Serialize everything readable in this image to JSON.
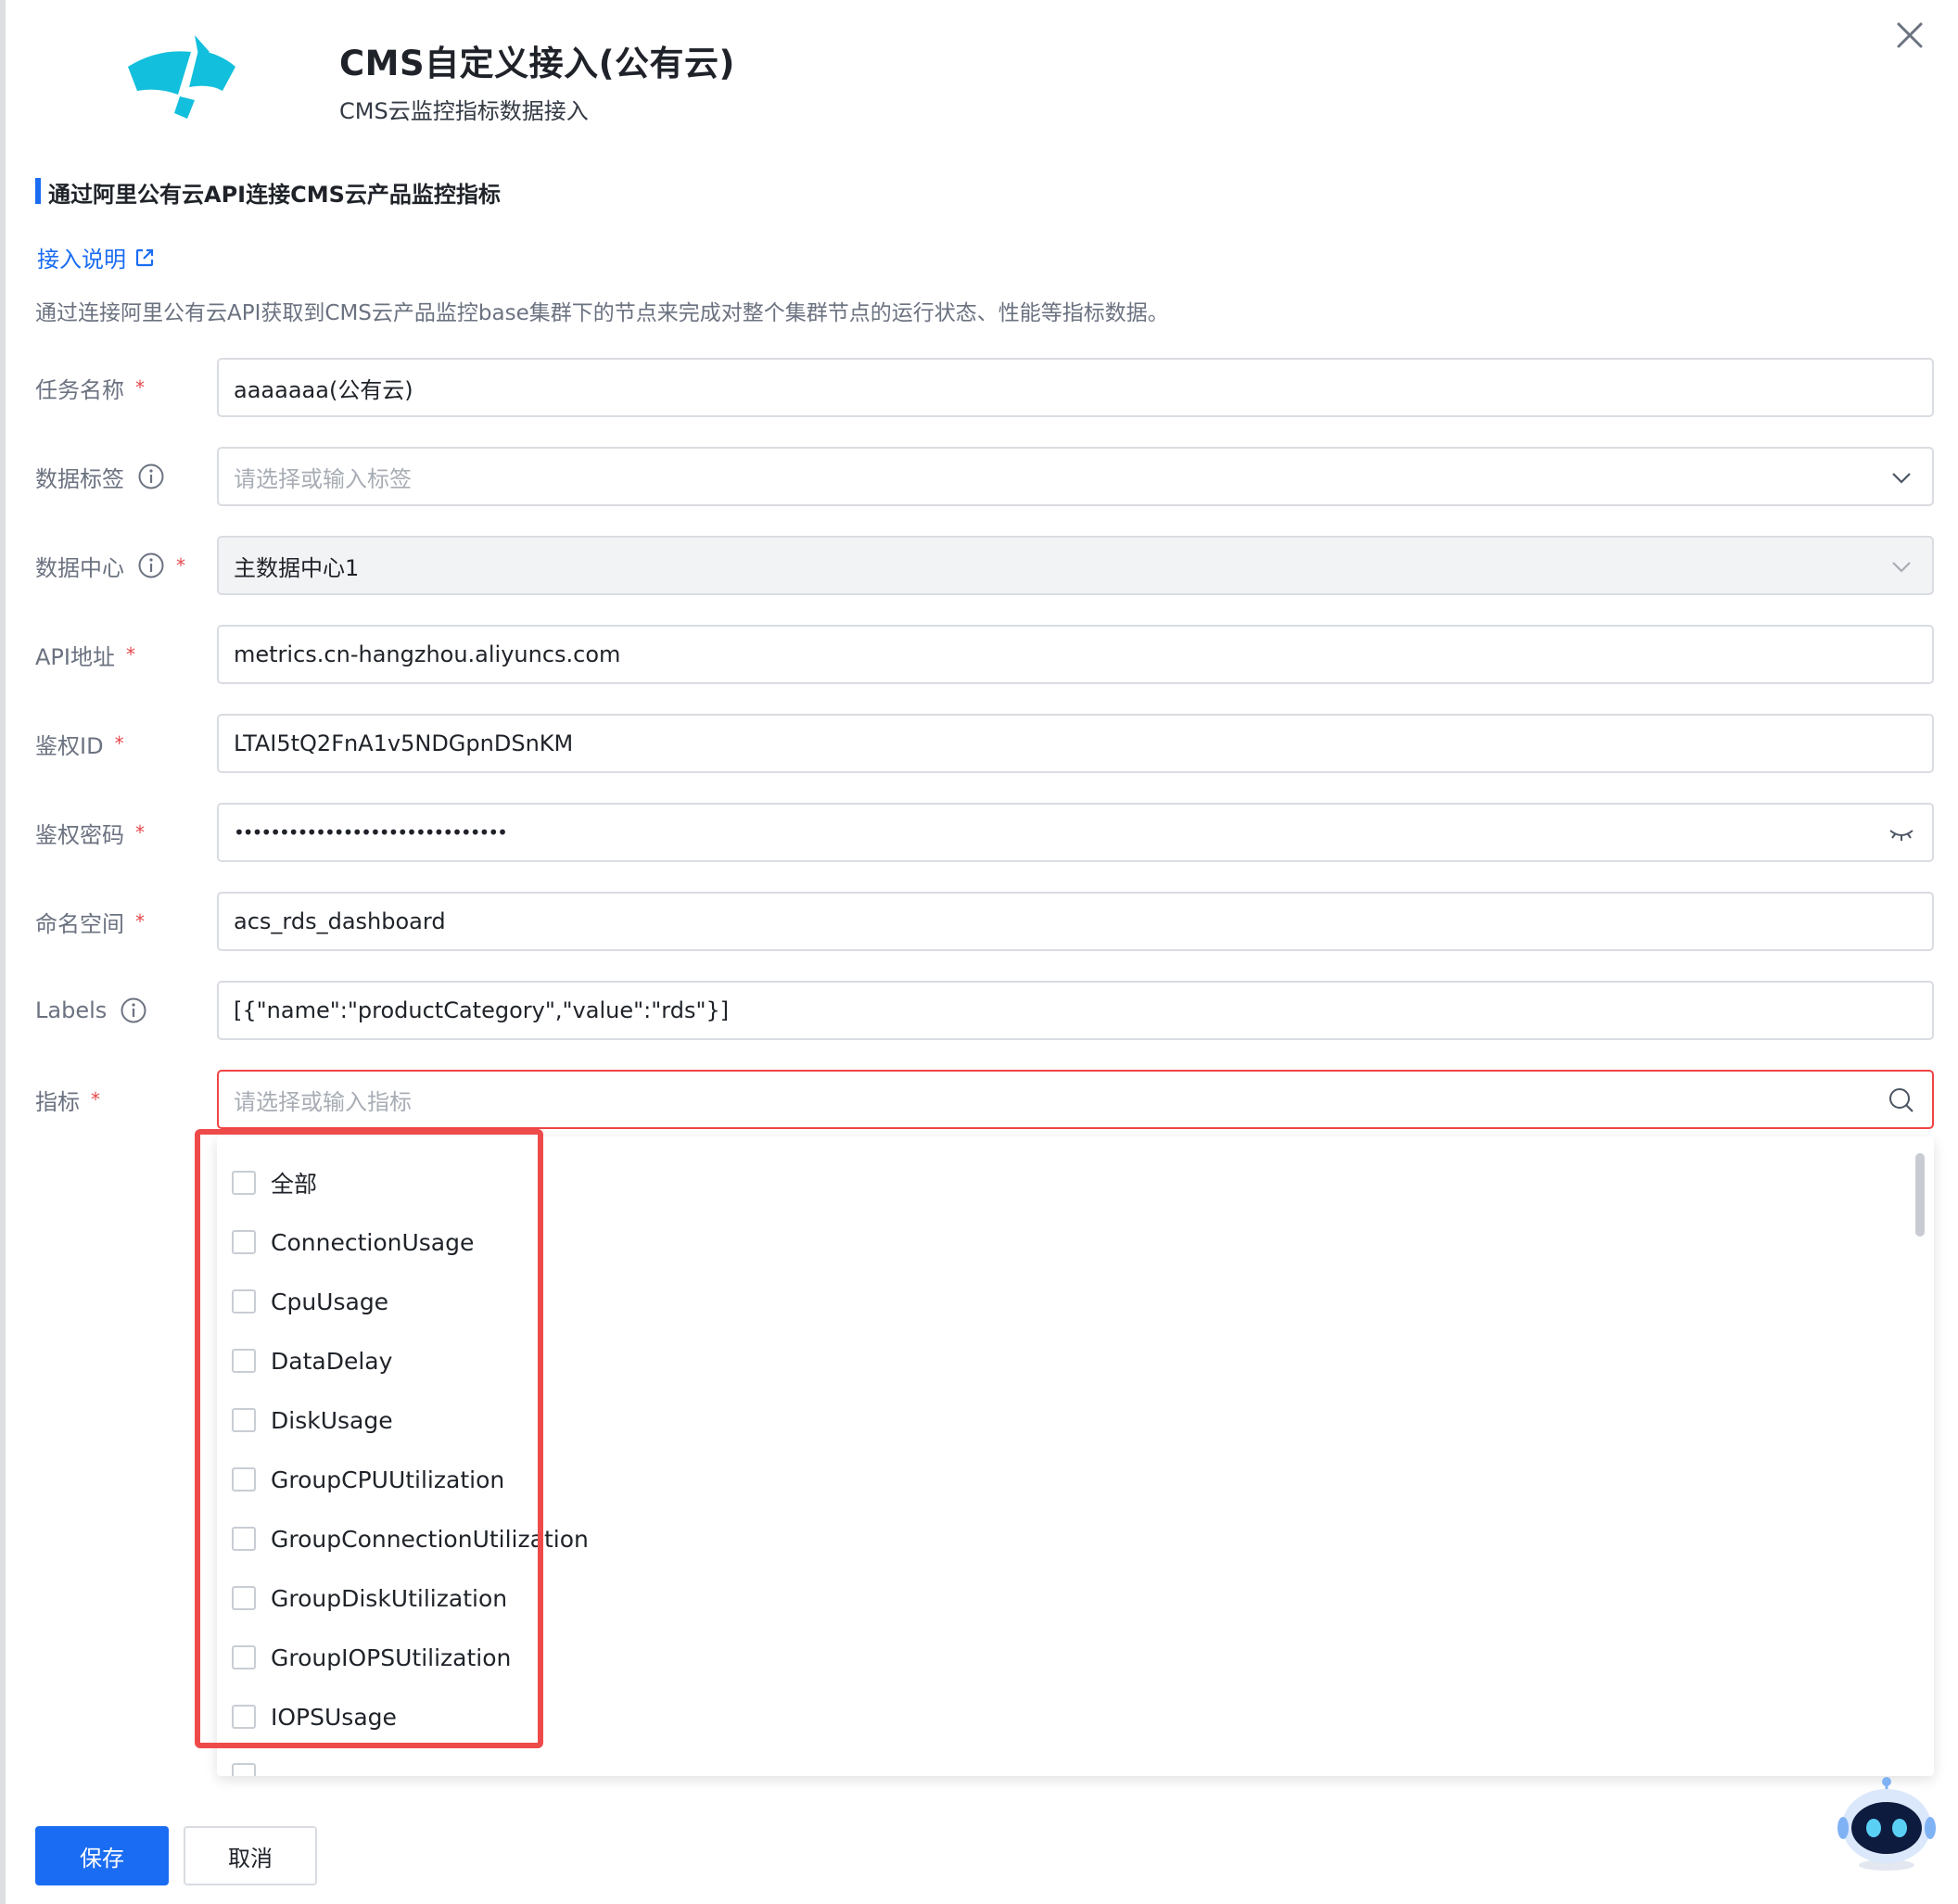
{
  "header": {
    "title": "CMS自定义接入(公有云)",
    "subtitle": "CMS云监控指标数据接入"
  },
  "section": {
    "title": "通过阿里公有云API连接CMS云产品监控指标",
    "doc_link": "接入说明",
    "description": "通过连接阿里公有云API获取到CMS云产品监控base集群下的节点来完成对整个集群节点的运行状态、性能等指标数据。"
  },
  "form": {
    "task_name": {
      "label": "任务名称",
      "value": "aaaaaaa(公有云)"
    },
    "data_tag": {
      "label": "数据标签",
      "placeholder": "请选择或输入标签"
    },
    "data_center": {
      "label": "数据中心",
      "value": "主数据中心1"
    },
    "api_address": {
      "label": "API地址",
      "value": "metrics.cn-hangzhou.aliyuncs.com"
    },
    "auth_id": {
      "label": "鉴权ID",
      "value": "LTAI5tQ2FnA1v5NDGpnDSnKM"
    },
    "auth_secret": {
      "label": "鉴权密码",
      "value": "••••••••••••••••••••••••••••••"
    },
    "namespace": {
      "label": "命名空间",
      "value": "acs_rds_dashboard"
    },
    "labels": {
      "label": "Labels",
      "value": "[{\"name\":\"productCategory\",\"value\":\"rds\"}]"
    },
    "metrics": {
      "label": "指标",
      "placeholder": "请选择或输入指标"
    }
  },
  "metric_options": [
    "全部",
    "ConnectionUsage",
    "CpuUsage",
    "DataDelay",
    "DiskUsage",
    "GroupCPUUtilization",
    "GroupConnectionUtilization",
    "GroupDiskUtilization",
    "GroupIOPSUtilization",
    "IOPSUsage"
  ],
  "actions": {
    "save": "保存",
    "cancel": "取消"
  },
  "colors": {
    "primary": "#1a6cf2",
    "required": "#e5484d",
    "highlight": "#ee4a4a",
    "logo": "#12bfdc"
  },
  "icons": [
    "close-icon",
    "external-link-icon",
    "info-icon",
    "chevron-down-icon",
    "eye-closed-icon",
    "search-icon",
    "robot-assistant-icon"
  ]
}
